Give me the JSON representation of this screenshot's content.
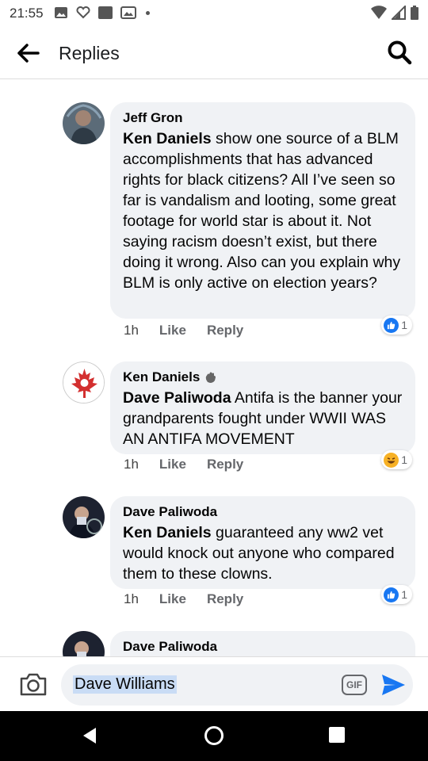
{
  "status_bar": {
    "time": "21:55"
  },
  "header": {
    "title": "Replies"
  },
  "comments": [
    {
      "author": "Jeff Gron",
      "mention": "Ken Daniels",
      "text": " show one source of a BLM accomplishments that has advanced rights for black citizens? All I’ve seen so far is vandalism and looting, some great footage for world star is about it. Not saying racism doesn’t exist, but there doing it wrong. Also can you explain why BLM is only active on election years?",
      "time": "1h",
      "like_label": "Like",
      "reply_label": "Reply",
      "reaction": {
        "type": "like",
        "count": "1"
      }
    },
    {
      "author": "Ken Daniels",
      "mention": "Dave Paliwoda",
      "text": " Antifa is the banner your grandparents fought under WWII WAS AN ANTIFA MOVEMENT",
      "time": "1h",
      "like_label": "Like",
      "reply_label": "Reply",
      "reaction": {
        "type": "haha",
        "count": "1"
      }
    },
    {
      "author": "Dave Paliwoda",
      "mention": "Ken Daniels",
      "text": " guaranteed any ww2 vet would knock out anyone who compared them to these clowns.",
      "time": "1h",
      "like_label": "Like",
      "reply_label": "Reply",
      "reaction": {
        "type": "like",
        "count": "1"
      }
    },
    {
      "author": "Dave Paliwoda"
    }
  ],
  "composer": {
    "value": "Dave Williams",
    "gif_label": "GIF"
  },
  "colors": {
    "accent": "#1877f2",
    "bubble": "#f0f2f5",
    "muted": "#65676b"
  }
}
